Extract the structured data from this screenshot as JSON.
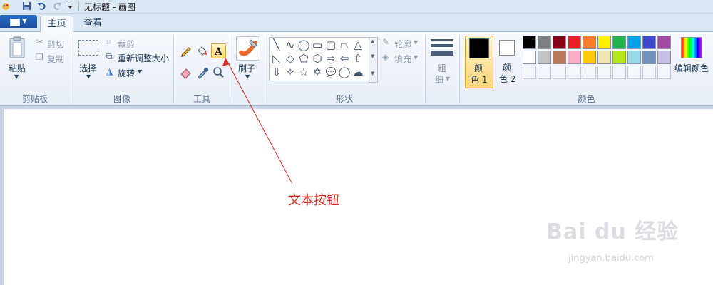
{
  "window": {
    "title": "无标题 - 画图"
  },
  "tabs": [
    {
      "label": "主页",
      "active": true
    },
    {
      "label": "查看",
      "active": false
    }
  ],
  "clipboard": {
    "paste_label": "粘贴",
    "cut_label": "剪切",
    "copy_label": "复制",
    "group_label": "剪贴板"
  },
  "image": {
    "select_label": "选择",
    "crop_label": "裁剪",
    "resize_label": "重新调整大小",
    "rotate_label": "旋转",
    "group_label": "图像"
  },
  "tools": {
    "group_label": "工具",
    "text_tool_active": true
  },
  "brush": {
    "label": "刷子"
  },
  "shapes": {
    "group_label": "形状",
    "outline_label": "轮廓",
    "fill_label": "填充",
    "icons": [
      "╲",
      "∿",
      "◯",
      "▭",
      "▢",
      "⏢",
      "△",
      "◺",
      "◇",
      "⬠",
      "⬡",
      "⇨",
      "⇦",
      "⇧",
      "⇩",
      "✧",
      "☆",
      "✡",
      "💬",
      "◯",
      "☁"
    ]
  },
  "size": {
    "label_line1": "粗",
    "label_line2": "细"
  },
  "colors": {
    "group_label": "颜色",
    "color1": {
      "line1": "颜",
      "line2": "色 1",
      "value": "#000000"
    },
    "color2": {
      "line1": "颜",
      "line2": "色 2",
      "value": "#ffffff"
    },
    "edit_label": "编辑颜色",
    "palette_row1": [
      "#000000",
      "#7f7f7f",
      "#880015",
      "#ed1c24",
      "#ff7f27",
      "#fff200",
      "#22b14c",
      "#00a2e8",
      "#3f48cc",
      "#a349a4"
    ],
    "palette_row2": [
      "#ffffff",
      "#c3c3c3",
      "#b97a57",
      "#ffaec9",
      "#ffc90e",
      "#efe4b0",
      "#b5e61d",
      "#99d9ea",
      "#7092be",
      "#c8bfe7"
    ]
  },
  "annotation": {
    "text": "文本按钮"
  },
  "watermark": {
    "logo": "Bai du 经验",
    "url": "jingyan.baidu.com"
  }
}
